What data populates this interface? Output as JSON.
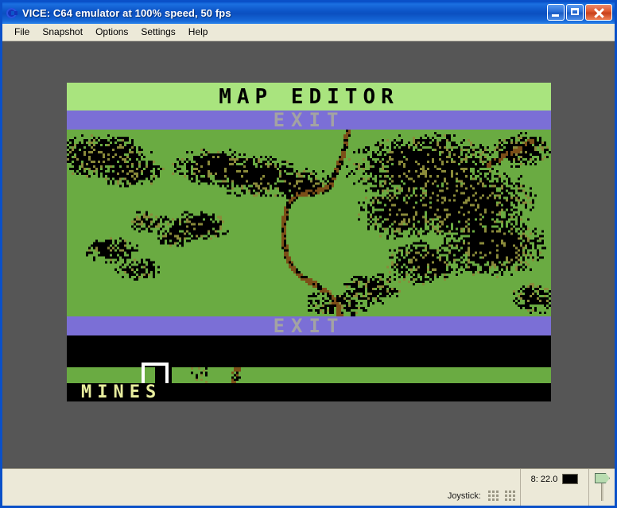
{
  "window": {
    "title": "VICE: C64 emulator at 100% speed, 50 fps",
    "icon": "commodore-c-icon",
    "controls": {
      "minimize": "minimize-icon",
      "maximize": "maximize-icon",
      "close": "close-icon"
    }
  },
  "menubar": {
    "items": [
      {
        "label": "File"
      },
      {
        "label": "Snapshot"
      },
      {
        "label": "Options"
      },
      {
        "label": "Settings"
      },
      {
        "label": "Help"
      }
    ]
  },
  "c64_screen": {
    "title_bar_text": "MAP EDITOR",
    "exit_top_text": "EXIT",
    "exit_bottom_text": "EXIT",
    "tile_label_text": "MINES",
    "colors": {
      "title_band": "#a9e47e",
      "title_text": "#000000",
      "exit_band": "#7b6fd6",
      "exit_text": "#a3a3a3",
      "map_grass": "#6aab42",
      "map_forest": "#000000",
      "map_path": "#7c4f18",
      "map_highlight": "#8a8a3a",
      "black_band": "#000000",
      "mines_text": "#e8ed9e",
      "cursor": "#ffffff"
    },
    "palette_strip": {
      "selected_index": 0,
      "tiles": [
        "grass",
        "black",
        "speckled",
        "mine"
      ]
    }
  },
  "statusbar": {
    "joystick_label": "Joystick:",
    "joystick_ports": 2,
    "drive_status": "8: 22.0",
    "drive_led_color": "#000000",
    "volume_slider": "tape-volume-slider"
  }
}
